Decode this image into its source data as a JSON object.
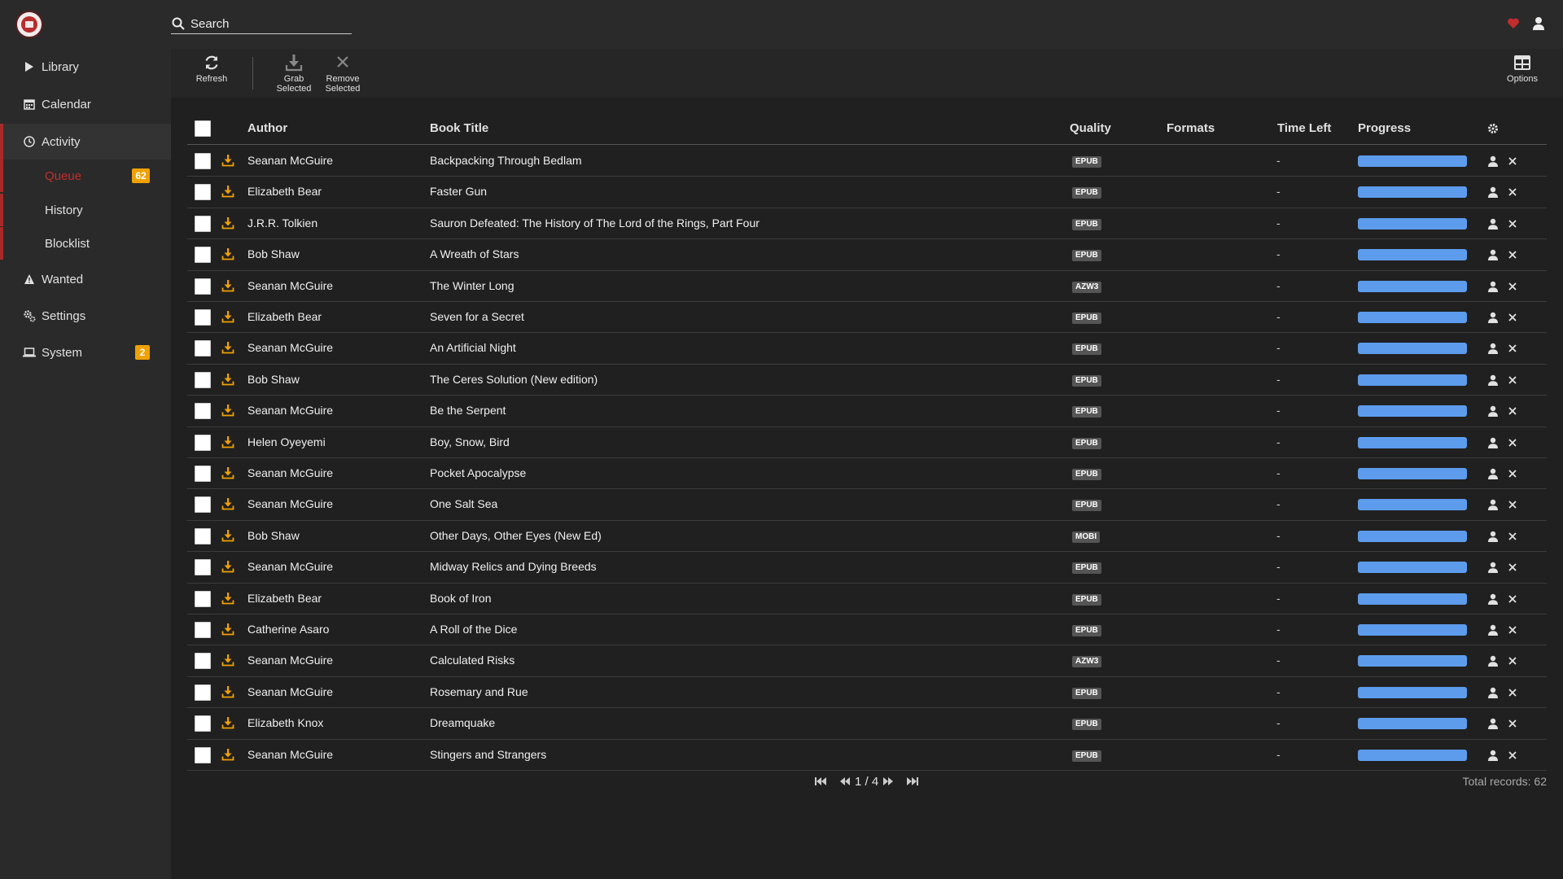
{
  "header": {
    "search_placeholder": "Search"
  },
  "sidebar": {
    "library": "Library",
    "calendar": "Calendar",
    "activity": "Activity",
    "queue": "Queue",
    "queue_count": "62",
    "history": "History",
    "blocklist": "Blocklist",
    "wanted": "Wanted",
    "settings": "Settings",
    "system": "System",
    "system_count": "2"
  },
  "toolbar": {
    "refresh": "Refresh",
    "grab_line1": "Grab",
    "grab_line2": "Selected",
    "remove_line1": "Remove",
    "remove_line2": "Selected",
    "options": "Options"
  },
  "table": {
    "headers": {
      "author": "Author",
      "title": "Book Title",
      "quality": "Quality",
      "formats": "Formats",
      "time_left": "Time Left",
      "progress": "Progress"
    },
    "rows": [
      {
        "author": "Seanan McGuire",
        "title": "Backpacking Through Bedlam",
        "quality": "EPUB",
        "time_left": "-",
        "progress": 1
      },
      {
        "author": "Elizabeth Bear",
        "title": "Faster Gun",
        "quality": "EPUB",
        "time_left": "-",
        "progress": 1
      },
      {
        "author": "J.R.R. Tolkien",
        "title": "Sauron Defeated: The History of The Lord of the Rings, Part Four",
        "quality": "EPUB",
        "time_left": "-",
        "progress": 1
      },
      {
        "author": "Bob Shaw",
        "title": "A Wreath of Stars",
        "quality": "EPUB",
        "time_left": "-",
        "progress": 1
      },
      {
        "author": "Seanan McGuire",
        "title": "The Winter Long",
        "quality": "AZW3",
        "time_left": "-",
        "progress": 1
      },
      {
        "author": "Elizabeth Bear",
        "title": "Seven for a Secret",
        "quality": "EPUB",
        "time_left": "-",
        "progress": 1
      },
      {
        "author": "Seanan McGuire",
        "title": "An Artificial Night",
        "quality": "EPUB",
        "time_left": "-",
        "progress": 1
      },
      {
        "author": "Bob Shaw",
        "title": "The Ceres Solution (New edition)",
        "quality": "EPUB",
        "time_left": "-",
        "progress": 1
      },
      {
        "author": "Seanan McGuire",
        "title": "Be the Serpent",
        "quality": "EPUB",
        "time_left": "-",
        "progress": 1
      },
      {
        "author": "Helen Oyeyemi",
        "title": "Boy, Snow, Bird",
        "quality": "EPUB",
        "time_left": "-",
        "progress": 1
      },
      {
        "author": "Seanan McGuire",
        "title": "Pocket Apocalypse",
        "quality": "EPUB",
        "time_left": "-",
        "progress": 1
      },
      {
        "author": "Seanan McGuire",
        "title": "One Salt Sea",
        "quality": "EPUB",
        "time_left": "-",
        "progress": 1
      },
      {
        "author": "Bob Shaw",
        "title": "Other Days, Other Eyes (New Ed)",
        "quality": "MOBI",
        "time_left": "-",
        "progress": 1
      },
      {
        "author": "Seanan McGuire",
        "title": "Midway Relics and Dying Breeds",
        "quality": "EPUB",
        "time_left": "-",
        "progress": 1
      },
      {
        "author": "Elizabeth Bear",
        "title": "Book of Iron",
        "quality": "EPUB",
        "time_left": "-",
        "progress": 1
      },
      {
        "author": "Catherine Asaro",
        "title": "A Roll of the Dice",
        "quality": "EPUB",
        "time_left": "-",
        "progress": 1
      },
      {
        "author": "Seanan McGuire",
        "title": "Calculated Risks",
        "quality": "AZW3",
        "time_left": "-",
        "progress": 1
      },
      {
        "author": "Seanan McGuire",
        "title": "Rosemary and Rue",
        "quality": "EPUB",
        "time_left": "-",
        "progress": 1
      },
      {
        "author": "Elizabeth Knox",
        "title": "Dreamquake",
        "quality": "EPUB",
        "time_left": "-",
        "progress": 1
      },
      {
        "author": "Seanan McGuire",
        "title": "Stingers and Strangers",
        "quality": "EPUB",
        "time_left": "-",
        "progress": 1
      }
    ]
  },
  "pager": {
    "page_info": "1 / 4",
    "total_records": "Total records: 62"
  },
  "colors": {
    "accent": "#a72a2a",
    "badge": "#f0a100",
    "progress": "#5d9cec",
    "download_icon": "#f0a100"
  },
  "icons": {
    "search": "search-icon",
    "heart": "heart-icon",
    "user": "user-icon",
    "refresh": "refresh-icon",
    "grab": "download-icon",
    "remove": "close-icon",
    "options": "table-options-icon"
  }
}
